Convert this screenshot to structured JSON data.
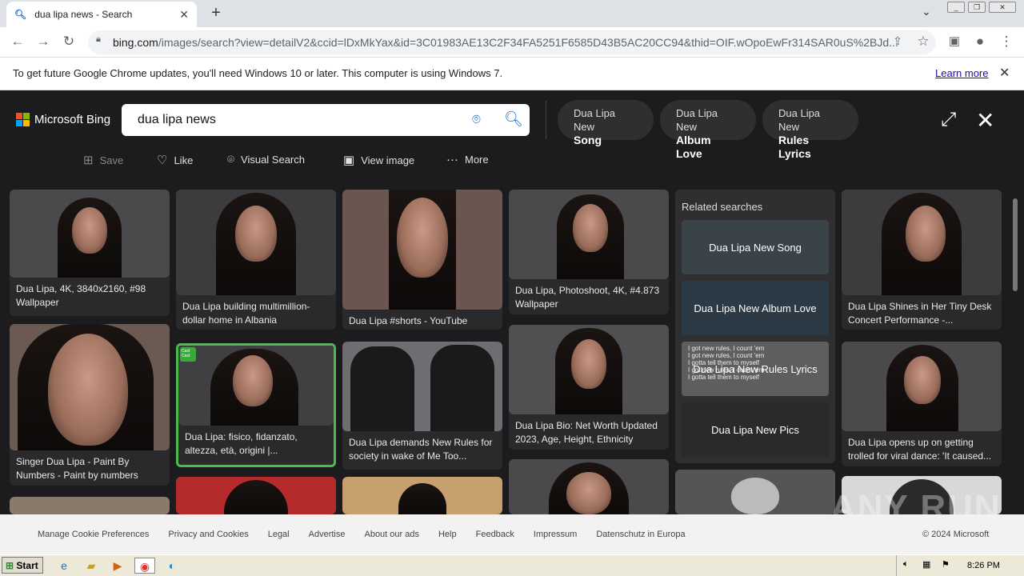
{
  "browser": {
    "tab_title": "dua lipa news - Search",
    "tab_favicon": "search-icon",
    "url_host": "bing.com",
    "url_path": "/images/search?view=detailV2&ccid=lDxMkYax&id=3C01983AE13C2F34FA5251F6585D43B5AC20CC94&thid=OIF.wOpoEwFr314SAR0uS%2BJd...",
    "infobar_message": "To get future Google Chrome updates, you'll need Windows 10 or later. This computer is using Windows 7.",
    "infobar_link": "Learn more"
  },
  "bing": {
    "brand": "Microsoft Bing",
    "query": "dua lipa news",
    "chips": [
      {
        "line1": "Dua Lipa New",
        "line2": "Song"
      },
      {
        "line1": "Dua Lipa New",
        "line2": "Album Love"
      },
      {
        "line1": "Dua Lipa New",
        "line2": "Rules Lyrics"
      }
    ],
    "actions": {
      "save": "Save",
      "like": "Like",
      "visual_search": "Visual Search",
      "view_image": "View image",
      "more": "More"
    }
  },
  "results": {
    "captions": [
      "Dua Lipa, 4K, 3840x2160, #98 Wallpaper",
      "Singer Dua Lipa - Paint By Numbers - Paint by numbers",
      "Dua Lipa building multimillion-dollar home in Albania",
      "Dua Lipa: fisico, fidanzato, altezza, età, origini |...",
      "Dua Lipa #shorts - YouTube",
      "Dua Lipa demands New Rules for society in wake of Me Too...",
      "Dua Lipa, Photoshoot, 4K, #4.873 Wallpaper",
      "Dua Lipa Bio: Net Worth Updated 2023, Age, Height, Ethnicity",
      "Dua Lipa Shines in Her Tiny Desk Concert Performance -...",
      "Dua Lipa opens up on getting trolled for viral dance: 'It caused..."
    ],
    "related_heading": "Related searches",
    "related": [
      "Dua Lipa New Song",
      "Dua Lipa New Album Love",
      "Dua Lipa New Rules Lyrics",
      "Dua Lipa New Pics"
    ],
    "related3_overlay": "I got new rules, I count 'em\nI got new rules, I count 'em\nI gotta tell them to myself\nI got new rules, I count 'em\nI gotta tell them to myself",
    "selected_badge": "Cast Cast"
  },
  "footer": {
    "links": [
      "Manage Cookie Preferences",
      "Privacy and Cookies",
      "Legal",
      "Advertise",
      "About our ads",
      "Help",
      "Feedback",
      "Impressum",
      "Datenschutz in Europa"
    ],
    "copyright": "© 2024 Microsoft"
  },
  "watermark": "ANY RUN",
  "taskbar": {
    "start": "Start",
    "clock": "8:26 PM"
  }
}
